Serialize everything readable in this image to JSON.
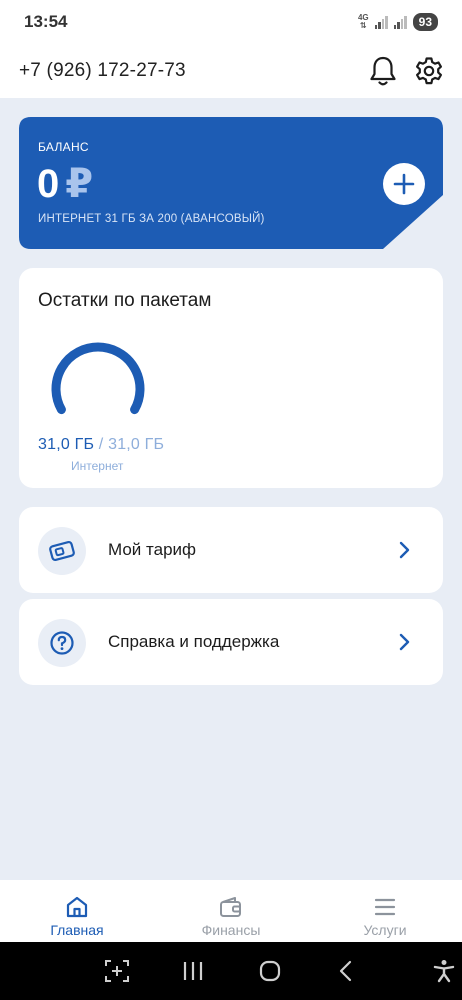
{
  "status_bar": {
    "time": "13:54",
    "network": "4G",
    "battery": "93"
  },
  "header": {
    "phone_number": "+7 (926) 172-27-73",
    "icons": [
      "bell-icon",
      "gear-icon"
    ]
  },
  "balance": {
    "label": "БАЛАНС",
    "amount": "0",
    "currency": "₽",
    "tariff": "ИНТЕРНЕТ 31 ГБ ЗА 200 (АВАНСОВЫЙ)",
    "accent_color": "#1d5cb4"
  },
  "packets": {
    "title": "Остатки по пакетам",
    "remaining": "31,0 ГБ",
    "separator": " / ",
    "total": "31,0 ГБ",
    "caption": "Интернет",
    "remaining_fraction": 1.0
  },
  "menu": {
    "tariff_label": "Мой тариф",
    "support_label": "Справка и поддержка"
  },
  "bottom_nav": {
    "items": [
      {
        "label": "Главная",
        "icon": "home-icon",
        "active": true
      },
      {
        "label": "Финансы",
        "icon": "wallet-icon",
        "active": false
      },
      {
        "label": "Услуги",
        "icon": "menu-icon",
        "active": false
      }
    ]
  }
}
